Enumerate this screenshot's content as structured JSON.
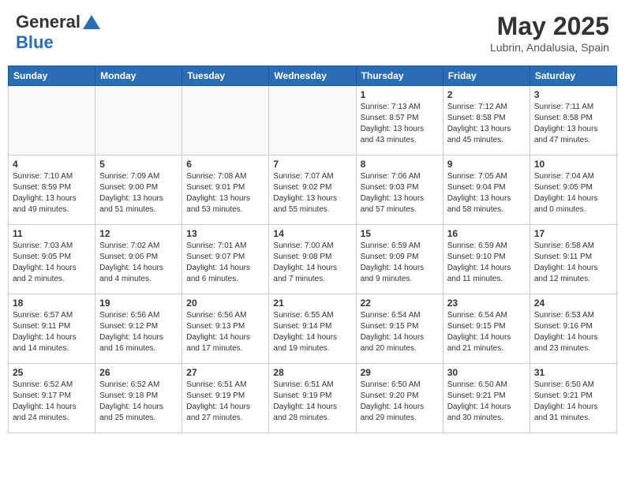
{
  "header": {
    "logo_line1": "General",
    "logo_line2": "Blue",
    "month_year": "May 2025",
    "location": "Lubrin, Andalusia, Spain"
  },
  "weekdays": [
    "Sunday",
    "Monday",
    "Tuesday",
    "Wednesday",
    "Thursday",
    "Friday",
    "Saturday"
  ],
  "weeks": [
    [
      {
        "day": "",
        "info": ""
      },
      {
        "day": "",
        "info": ""
      },
      {
        "day": "",
        "info": ""
      },
      {
        "day": "",
        "info": ""
      },
      {
        "day": "1",
        "info": "Sunrise: 7:13 AM\nSunset: 8:57 PM\nDaylight: 13 hours\nand 43 minutes."
      },
      {
        "day": "2",
        "info": "Sunrise: 7:12 AM\nSunset: 8:58 PM\nDaylight: 13 hours\nand 45 minutes."
      },
      {
        "day": "3",
        "info": "Sunrise: 7:11 AM\nSunset: 8:58 PM\nDaylight: 13 hours\nand 47 minutes."
      }
    ],
    [
      {
        "day": "4",
        "info": "Sunrise: 7:10 AM\nSunset: 8:59 PM\nDaylight: 13 hours\nand 49 minutes."
      },
      {
        "day": "5",
        "info": "Sunrise: 7:09 AM\nSunset: 9:00 PM\nDaylight: 13 hours\nand 51 minutes."
      },
      {
        "day": "6",
        "info": "Sunrise: 7:08 AM\nSunset: 9:01 PM\nDaylight: 13 hours\nand 53 minutes."
      },
      {
        "day": "7",
        "info": "Sunrise: 7:07 AM\nSunset: 9:02 PM\nDaylight: 13 hours\nand 55 minutes."
      },
      {
        "day": "8",
        "info": "Sunrise: 7:06 AM\nSunset: 9:03 PM\nDaylight: 13 hours\nand 57 minutes."
      },
      {
        "day": "9",
        "info": "Sunrise: 7:05 AM\nSunset: 9:04 PM\nDaylight: 13 hours\nand 58 minutes."
      },
      {
        "day": "10",
        "info": "Sunrise: 7:04 AM\nSunset: 9:05 PM\nDaylight: 14 hours\nand 0 minutes."
      }
    ],
    [
      {
        "day": "11",
        "info": "Sunrise: 7:03 AM\nSunset: 9:05 PM\nDaylight: 14 hours\nand 2 minutes."
      },
      {
        "day": "12",
        "info": "Sunrise: 7:02 AM\nSunset: 9:06 PM\nDaylight: 14 hours\nand 4 minutes."
      },
      {
        "day": "13",
        "info": "Sunrise: 7:01 AM\nSunset: 9:07 PM\nDaylight: 14 hours\nand 6 minutes."
      },
      {
        "day": "14",
        "info": "Sunrise: 7:00 AM\nSunset: 9:08 PM\nDaylight: 14 hours\nand 7 minutes."
      },
      {
        "day": "15",
        "info": "Sunrise: 6:59 AM\nSunset: 9:09 PM\nDaylight: 14 hours\nand 9 minutes."
      },
      {
        "day": "16",
        "info": "Sunrise: 6:59 AM\nSunset: 9:10 PM\nDaylight: 14 hours\nand 11 minutes."
      },
      {
        "day": "17",
        "info": "Sunrise: 6:58 AM\nSunset: 9:11 PM\nDaylight: 14 hours\nand 12 minutes."
      }
    ],
    [
      {
        "day": "18",
        "info": "Sunrise: 6:57 AM\nSunset: 9:11 PM\nDaylight: 14 hours\nand 14 minutes."
      },
      {
        "day": "19",
        "info": "Sunrise: 6:56 AM\nSunset: 9:12 PM\nDaylight: 14 hours\nand 16 minutes."
      },
      {
        "day": "20",
        "info": "Sunrise: 6:56 AM\nSunset: 9:13 PM\nDaylight: 14 hours\nand 17 minutes."
      },
      {
        "day": "21",
        "info": "Sunrise: 6:55 AM\nSunset: 9:14 PM\nDaylight: 14 hours\nand 19 minutes."
      },
      {
        "day": "22",
        "info": "Sunrise: 6:54 AM\nSunset: 9:15 PM\nDaylight: 14 hours\nand 20 minutes."
      },
      {
        "day": "23",
        "info": "Sunrise: 6:54 AM\nSunset: 9:15 PM\nDaylight: 14 hours\nand 21 minutes."
      },
      {
        "day": "24",
        "info": "Sunrise: 6:53 AM\nSunset: 9:16 PM\nDaylight: 14 hours\nand 23 minutes."
      }
    ],
    [
      {
        "day": "25",
        "info": "Sunrise: 6:52 AM\nSunset: 9:17 PM\nDaylight: 14 hours\nand 24 minutes."
      },
      {
        "day": "26",
        "info": "Sunrise: 6:52 AM\nSunset: 9:18 PM\nDaylight: 14 hours\nand 25 minutes."
      },
      {
        "day": "27",
        "info": "Sunrise: 6:51 AM\nSunset: 9:19 PM\nDaylight: 14 hours\nand 27 minutes."
      },
      {
        "day": "28",
        "info": "Sunrise: 6:51 AM\nSunset: 9:19 PM\nDaylight: 14 hours\nand 28 minutes."
      },
      {
        "day": "29",
        "info": "Sunrise: 6:50 AM\nSunset: 9:20 PM\nDaylight: 14 hours\nand 29 minutes."
      },
      {
        "day": "30",
        "info": "Sunrise: 6:50 AM\nSunset: 9:21 PM\nDaylight: 14 hours\nand 30 minutes."
      },
      {
        "day": "31",
        "info": "Sunrise: 6:50 AM\nSunset: 9:21 PM\nDaylight: 14 hours\nand 31 minutes."
      }
    ]
  ]
}
